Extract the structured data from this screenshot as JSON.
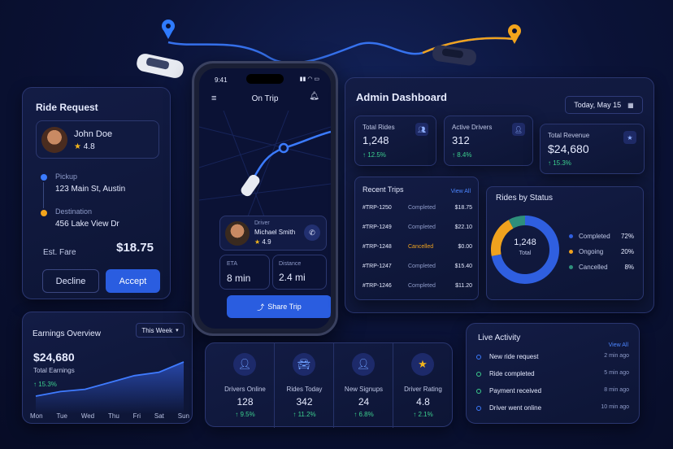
{
  "ride_request": {
    "title": "Ride Request",
    "rider_name": "John Doe",
    "rating": "4.8",
    "pickup_label": "Pickup",
    "pickup_address": "123 Main St, Austin",
    "destination_label": "Destination",
    "destination_address": "456 Lake View Dr",
    "fare_label": "Est. Fare",
    "fare_value": "$18.75",
    "decline_label": "Decline",
    "accept_label": "Accept"
  },
  "earnings": {
    "title": "Earnings Overview",
    "period": "This Week",
    "value": "$24,680",
    "subtitle": "Total Earnings",
    "change": "15.3%",
    "days": [
      "Mon",
      "Tue",
      "Wed",
      "Thu",
      "Fri",
      "Sat",
      "Sun"
    ]
  },
  "phone": {
    "time": "9:41",
    "status_icons": "▮▮ ◠ ▭",
    "title": "On Trip",
    "driver_label": "Driver",
    "driver_name": "Michael Smith",
    "driver_rating": "4.9",
    "eta_label": "ETA",
    "eta_value": "8 min",
    "distance_label": "Distance",
    "distance_value": "2.4 mi",
    "share_label": "Share Trip"
  },
  "dashboard": {
    "title": "Admin Dashboard",
    "date": "Today, May 15",
    "kpis": [
      {
        "label": "Total Rides",
        "value": "1,248",
        "change": "12.5%",
        "icon": "users-icon",
        "glyph": "👥︎"
      },
      {
        "label": "Active Drivers",
        "value": "312",
        "change": "8.4%",
        "icon": "person-icon",
        "glyph": "👤︎"
      },
      {
        "label": "Total Revenue",
        "value": "$24,680",
        "change": "15.3%",
        "icon": "star-badge-icon",
        "glyph": "★"
      }
    ],
    "recent_trips_title": "Recent Trips",
    "view_all": "View All",
    "trips": [
      {
        "id": "#TRP-1250",
        "status": "Completed",
        "amount": "$18.75"
      },
      {
        "id": "#TRP-1249",
        "status": "Completed",
        "amount": "$22.10"
      },
      {
        "id": "#TRP-1248",
        "status": "Cancelled",
        "amount": "$0.00"
      },
      {
        "id": "#TRP-1247",
        "status": "Completed",
        "amount": "$15.40"
      },
      {
        "id": "#TRP-1246",
        "status": "Completed",
        "amount": "$11.20"
      }
    ],
    "status_title": "Rides by Status",
    "status_total": "1,248",
    "status_total_label": "Total",
    "status": [
      {
        "label": "Completed",
        "pct": "72%",
        "value": 72,
        "color": "#2f5fe0"
      },
      {
        "label": "Ongoing",
        "pct": "20%",
        "value": 20,
        "color": "#f0a21e"
      },
      {
        "label": "Cancelled",
        "pct": "8%",
        "value": 8,
        "color": "#2e8f7c"
      }
    ]
  },
  "stats": [
    {
      "label": "Drivers Online",
      "value": "128",
      "change": "9.5%",
      "icon": "driver-icon",
      "glyph": "👤︎",
      "color": "#6ea0ff"
    },
    {
      "label": "Rides Today",
      "value": "342",
      "change": "11.2%",
      "icon": "car-icon",
      "glyph": "🚘︎",
      "color": "#6ea0ff"
    },
    {
      "label": "New Signups",
      "value": "24",
      "change": "6.8%",
      "icon": "add-user-icon",
      "glyph": "👤︎",
      "color": "#6ea0ff"
    },
    {
      "label": "Driver Rating",
      "value": "4.8",
      "change": "2.1%",
      "icon": "star-icon",
      "glyph": "★",
      "color": "#f3b51c"
    }
  ],
  "activity": {
    "title": "Live Activity",
    "view_all": "View All",
    "items": [
      {
        "text": "New ride request",
        "time": "2 min ago",
        "color": "#3b7bff"
      },
      {
        "text": "Ride completed",
        "time": "5 min ago",
        "color": "#3ccf8e"
      },
      {
        "text": "Payment received",
        "time": "8 min ago",
        "color": "#3ccf8e"
      },
      {
        "text": "Driver went online",
        "time": "10 min ago",
        "color": "#3b7bff"
      }
    ]
  },
  "chart_data": {
    "type": "area",
    "x": [
      "Mon",
      "Tue",
      "Wed",
      "Thu",
      "Fri",
      "Sat",
      "Sun"
    ],
    "values": [
      10,
      14,
      16,
      22,
      28,
      31,
      40
    ]
  }
}
